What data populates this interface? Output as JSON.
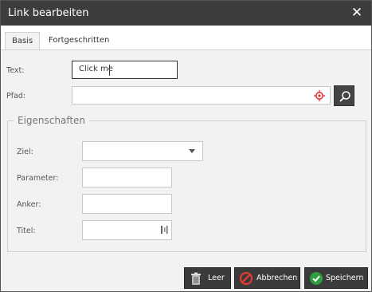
{
  "dialog": {
    "title": "Link bearbeiten",
    "close_glyph": "✕"
  },
  "tabs": [
    {
      "label": "Basis",
      "active": true
    },
    {
      "label": "Fortgeschritten",
      "active": false
    }
  ],
  "basis": {
    "text_label": "Text:",
    "text_value": "Click me",
    "path_label": "Pfad:",
    "path_value": ""
  },
  "properties": {
    "legend": "Eigenschaften",
    "target_label": "Ziel:",
    "target_value": "",
    "params_label": "Parameter:",
    "params_value": "",
    "anchor_label": "Anker:",
    "anchor_value": "",
    "title_label": "Titel:",
    "title_value": ""
  },
  "footer": {
    "clear_label": "Leer",
    "cancel_label": "Abbrechen",
    "save_label": "Speichern"
  },
  "colors": {
    "titlebar": "#3d3d3d",
    "button": "#3b3b3b",
    "cancel_icon": "#e53935",
    "save_icon": "#2e9e3e",
    "target_icon": "#e53935"
  },
  "icons": {
    "close": "close-icon",
    "target": "target-icon",
    "search": "search-icon",
    "select": "chevron-down-icon",
    "picker": "picker-icon",
    "clear": "trash-icon",
    "cancel": "cancel-icon",
    "save": "check-icon"
  }
}
